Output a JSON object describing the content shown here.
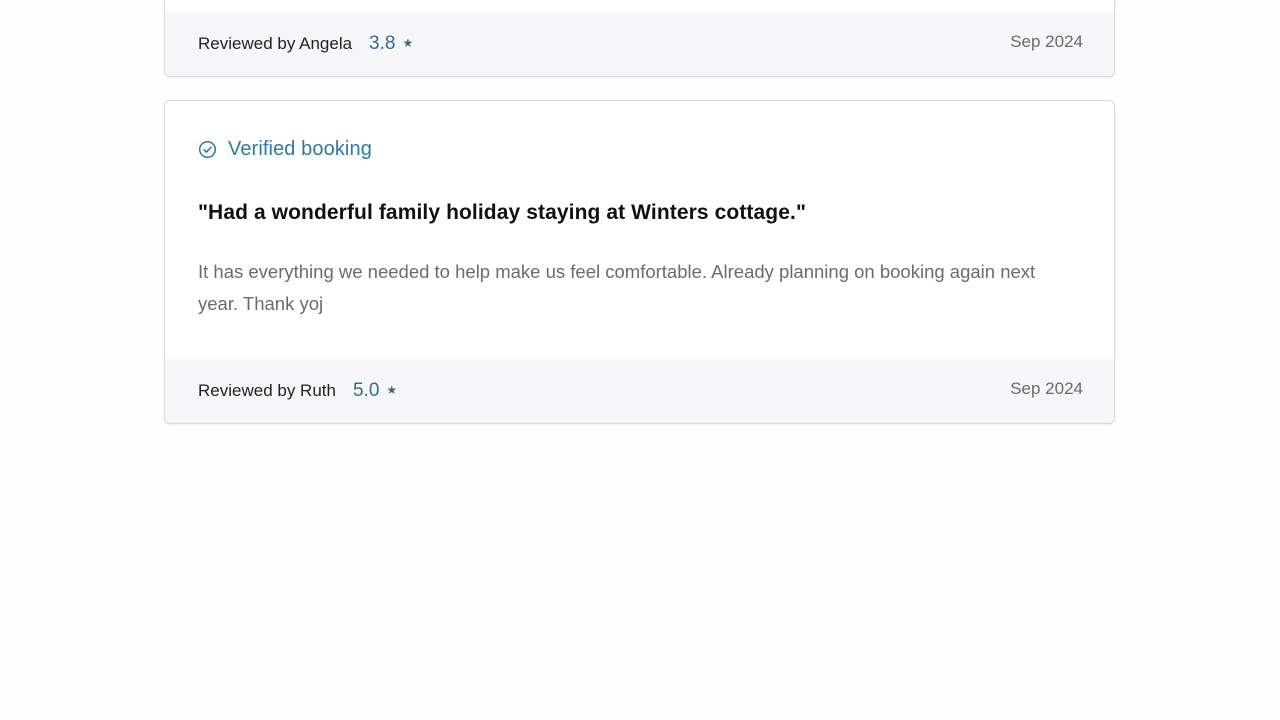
{
  "reviews": [
    {
      "reviewer": "Reviewed by Angela",
      "rating": "3.8",
      "star": "★",
      "date": "Sep 2024"
    },
    {
      "verified_label": "Verified booking",
      "verified_icon": "check-circle-icon",
      "title": "\"Had a wonderful family holiday staying at Winters cottage.\"",
      "text": "It has everything we needed to help make us feel comfortable. Already planning on booking again next year. Thank yoj",
      "reviewer": "Reviewed by Ruth",
      "rating": "5.0",
      "star": "★",
      "date": "Sep 2024"
    }
  ],
  "colors": {
    "accent": "#2a7ba6",
    "rating": "#3a6b86",
    "footer_bg": "#f5f6f7",
    "border": "#d9d9d9"
  }
}
